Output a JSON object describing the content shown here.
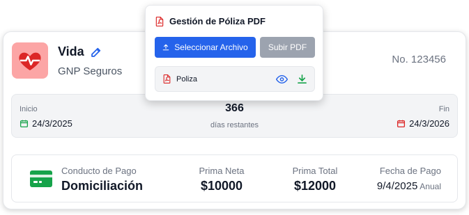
{
  "policy": {
    "type": "Vida",
    "insurer": "GNP Seguros",
    "number": "No. 123456",
    "colors": {
      "accent": "#fca5a5",
      "heart": "#dc2626",
      "edit": "#2563eb"
    }
  },
  "validity": {
    "start_label": "Inicio",
    "start_date": "24/3/2025",
    "days": "366",
    "days_label": "días restantes",
    "end_label": "Fin",
    "end_date": "24/3/2026",
    "colors": {
      "start": "#16a34a",
      "end": "#dc2626"
    }
  },
  "payment": {
    "conduct_label": "Conducto de Pago",
    "conduct_value": "Domiciliación",
    "prima_neta_label": "Prima Neta",
    "prima_neta_value": "$10000",
    "prima_total_label": "Prima Total",
    "prima_total_value": "$12000",
    "fecha_label": "Fecha de Pago",
    "fecha_value": "9/4/2025",
    "frequency": "Anual",
    "icon_color": "#16a34a"
  },
  "pdf_popover": {
    "title": "Gestión de Póliza PDF",
    "select_button": "Seleccionar Archivo",
    "upload_button": "Subir PDF",
    "file_name": "Poliza",
    "colors": {
      "primary": "#2563eb",
      "disabled": "#9ca3af",
      "view": "#2563eb",
      "download": "#16a34a",
      "pdf": "#dc2626"
    }
  },
  "icons": [
    "heartbeat-icon",
    "edit-icon",
    "calendar-icon",
    "credit-card-icon",
    "pdf-file-icon",
    "upload-icon",
    "eye-icon",
    "download-icon"
  ]
}
